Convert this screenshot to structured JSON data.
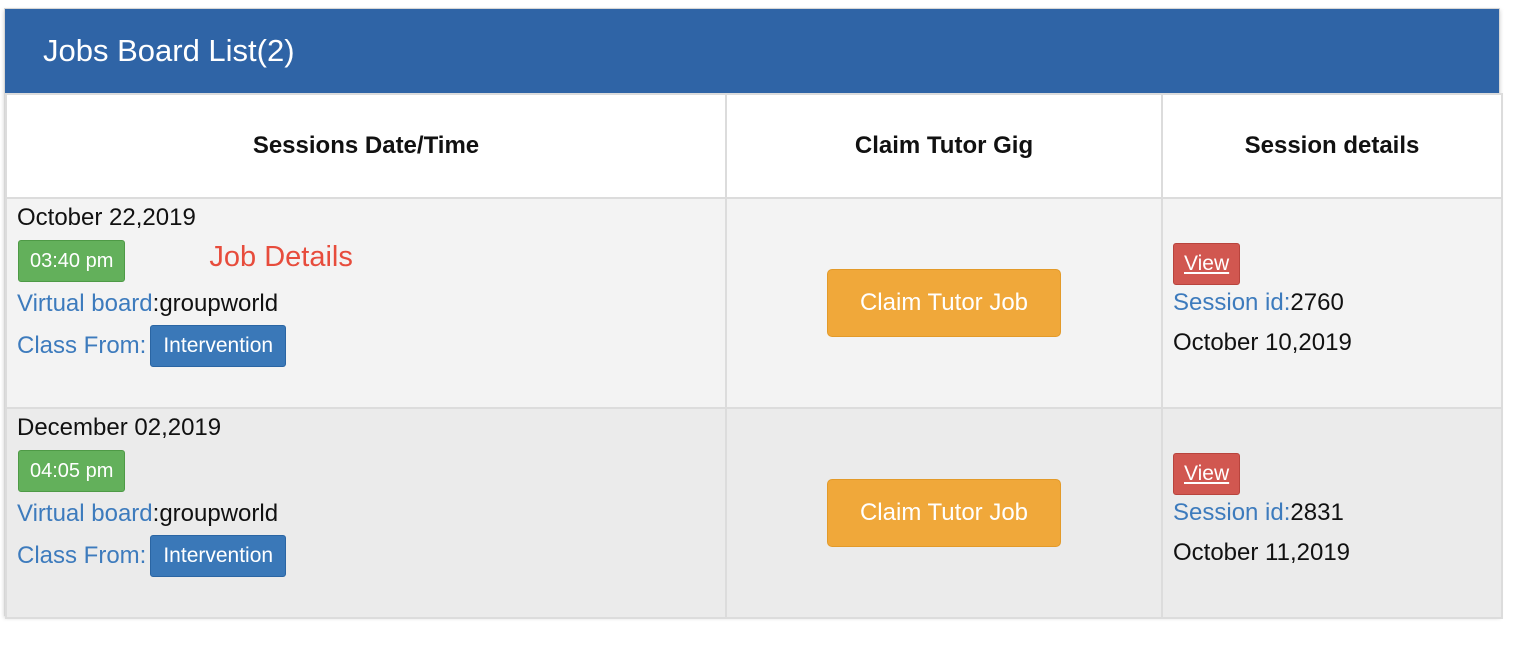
{
  "panel": {
    "title": "Jobs Board List(2)"
  },
  "table": {
    "headers": [
      "Sessions Date/Time",
      "Claim Tutor Gig",
      "Session details"
    ],
    "rows": [
      {
        "date": "October 22,2019",
        "time": "03:40 pm",
        "job_details_label": "Job Details",
        "virtual_board_label": "Virtual board",
        "virtual_board_value": ":groupworld",
        "class_from_label": "Class From:",
        "class_from_value": "Intervention",
        "claim_label": "Claim Tutor Job",
        "view_label": "View",
        "session_id_label": "Session id:",
        "session_id_value": "2760",
        "session_date": "October 10,2019"
      },
      {
        "date": "December 02,2019",
        "time": "04:05 pm",
        "job_details_label": "",
        "virtual_board_label": "Virtual board",
        "virtual_board_value": ":groupworld",
        "class_from_label": "Class From:",
        "class_from_value": "Intervention",
        "claim_label": "Claim Tutor Job",
        "view_label": "View",
        "session_id_label": "Session id:",
        "session_id_value": "2831",
        "session_date": "October 11,2019"
      }
    ]
  },
  "colors": {
    "header_bg": "#2f64a6",
    "time_badge": "#63b05b",
    "class_badge": "#3a78b8",
    "claim_button": "#f0a83a",
    "view_button": "#d15750",
    "job_details_text": "#e74c3c",
    "label_text": "#3d7bbd"
  }
}
